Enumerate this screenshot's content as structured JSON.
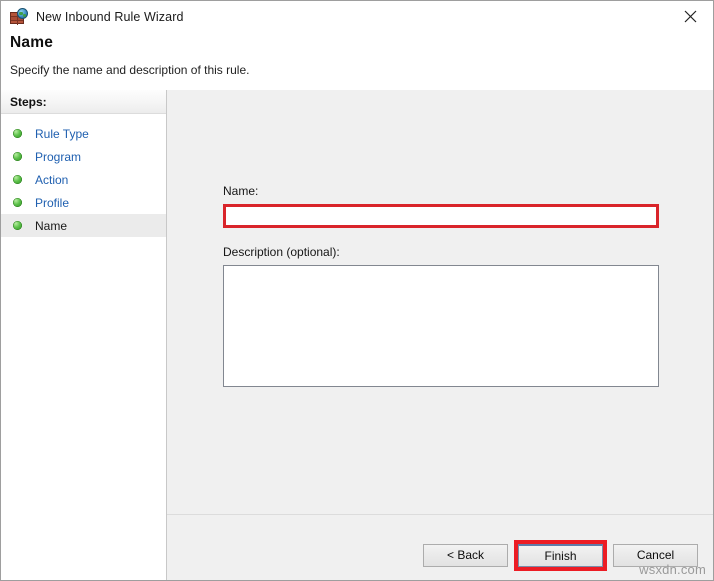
{
  "window": {
    "title": "New Inbound Rule Wizard",
    "title_icon": "firewall-globe-icon",
    "close_icon": "close-icon"
  },
  "header": {
    "heading": "Name",
    "subtitle": "Specify the name and description of this rule."
  },
  "sidebar": {
    "header": "Steps:",
    "items": [
      {
        "label": "Rule Type",
        "bullet": "green-dot-icon",
        "current": false
      },
      {
        "label": "Program",
        "bullet": "green-dot-icon",
        "current": false
      },
      {
        "label": "Action",
        "bullet": "green-dot-icon",
        "current": false
      },
      {
        "label": "Profile",
        "bullet": "green-dot-icon",
        "current": false
      },
      {
        "label": "Name",
        "bullet": "green-dot-icon",
        "current": true
      }
    ]
  },
  "form": {
    "name_label": "Name:",
    "name_value": "",
    "name_placeholder": "",
    "description_label": "Description (optional):",
    "description_value": "",
    "description_placeholder": ""
  },
  "footer": {
    "back_label": "< Back",
    "finish_label": "Finish",
    "cancel_label": "Cancel"
  },
  "watermark": "wsxdn.com",
  "colors": {
    "highlight_red": "#ec1c24",
    "field_highlight_red": "#d9242a",
    "link_blue": "#2060b0",
    "content_bg": "#f0f0f0",
    "sidebar_bg": "#ffffff"
  }
}
